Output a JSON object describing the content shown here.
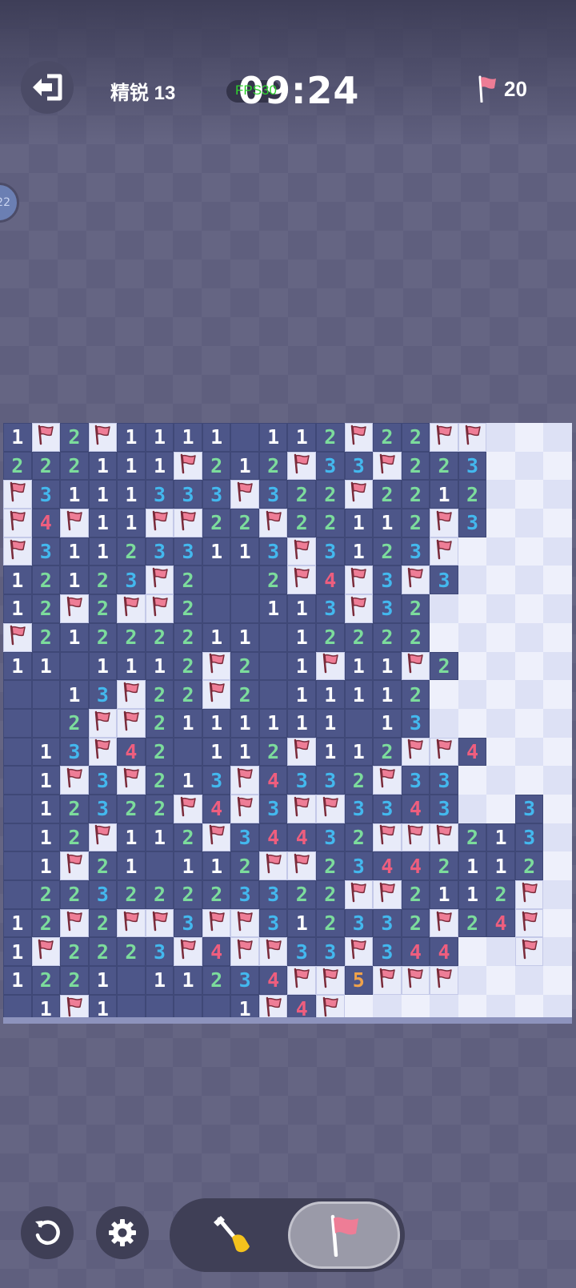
{
  "header": {
    "level_label": "精锐 13",
    "fps_label": "FPS30",
    "timer": "09:24",
    "flags_remaining": "20"
  },
  "side_badge": "22",
  "icons": {
    "exit": "exit-icon",
    "flag": "flag-icon",
    "restart": "restart-icon",
    "settings": "gear-icon",
    "dig": "shovel-icon"
  },
  "colors": {
    "revealed": "#4d5689",
    "n1": "#ffffff",
    "n2": "#7cdc9c",
    "n3": "#43b8ee",
    "n4": "#ee5e7e",
    "n5": "#f0a24a",
    "flag": "#ee7d96"
  },
  "board": {
    "cols": 20,
    "rows": [
      [
        "1",
        "F",
        "2",
        "F",
        "1",
        "1",
        "1",
        "1",
        "0",
        "1",
        "1",
        "2",
        "F",
        "2",
        "2",
        "F",
        "F",
        "H",
        "H",
        "H"
      ],
      [
        "2",
        "2",
        "2",
        "1",
        "1",
        "1",
        "F",
        "2",
        "1",
        "2",
        "F",
        "3",
        "3",
        "F",
        "2",
        "2",
        "3",
        "H",
        "H",
        "H"
      ],
      [
        "F",
        "3",
        "1",
        "1",
        "1",
        "3",
        "3",
        "3",
        "F",
        "3",
        "2",
        "2",
        "F",
        "2",
        "2",
        "1",
        "2",
        "H",
        "H",
        "H"
      ],
      [
        "F",
        "4",
        "F",
        "1",
        "1",
        "F",
        "F",
        "2",
        "2",
        "F",
        "2",
        "2",
        "1",
        "1",
        "2",
        "F",
        "3",
        "H",
        "H",
        "H"
      ],
      [
        "F",
        "3",
        "1",
        "1",
        "2",
        "3",
        "3",
        "1",
        "1",
        "3",
        "F",
        "3",
        "1",
        "2",
        "3",
        "F",
        "H",
        "H",
        "H",
        "H"
      ],
      [
        "1",
        "2",
        "1",
        "2",
        "3",
        "F",
        "2",
        "0",
        "0",
        "2",
        "F",
        "4",
        "F",
        "3",
        "F",
        "3",
        "H",
        "H",
        "H",
        "H"
      ],
      [
        "1",
        "2",
        "F",
        "2",
        "F",
        "F",
        "2",
        "0",
        "0",
        "1",
        "1",
        "3",
        "F",
        "3",
        "2",
        "H",
        "H",
        "H",
        "H",
        "H"
      ],
      [
        "F",
        "2",
        "1",
        "2",
        "2",
        "2",
        "2",
        "1",
        "1",
        "0",
        "1",
        "2",
        "2",
        "2",
        "2",
        "H",
        "H",
        "H",
        "H",
        "H"
      ],
      [
        "1",
        "1",
        "0",
        "1",
        "1",
        "1",
        "2",
        "F",
        "2",
        "0",
        "1",
        "F",
        "1",
        "1",
        "F",
        "2",
        "H",
        "H",
        "H",
        "H"
      ],
      [
        "0",
        "0",
        "1",
        "3",
        "F",
        "2",
        "2",
        "F",
        "2",
        "0",
        "1",
        "1",
        "1",
        "1",
        "2",
        "H",
        "H",
        "H",
        "H",
        "H"
      ],
      [
        "0",
        "0",
        "2",
        "F",
        "F",
        "2",
        "1",
        "1",
        "1",
        "1",
        "1",
        "1",
        "0",
        "1",
        "3",
        "H",
        "H",
        "H",
        "H",
        "H"
      ],
      [
        "0",
        "1",
        "3",
        "F",
        "4",
        "2",
        "0",
        "1",
        "1",
        "2",
        "F",
        "1",
        "1",
        "2",
        "F",
        "F",
        "4",
        "H",
        "H",
        "H"
      ],
      [
        "0",
        "1",
        "F",
        "3",
        "F",
        "2",
        "1",
        "3",
        "F",
        "4",
        "3",
        "3",
        "2",
        "F",
        "3",
        "3",
        "H",
        "H",
        "H",
        "H"
      ],
      [
        "0",
        "1",
        "2",
        "3",
        "2",
        "2",
        "F",
        "4",
        "F",
        "3",
        "F",
        "F",
        "3",
        "3",
        "4",
        "3",
        "H",
        "H",
        "3",
        "H"
      ],
      [
        "0",
        "1",
        "2",
        "F",
        "1",
        "1",
        "2",
        "F",
        "3",
        "4",
        "4",
        "3",
        "2",
        "F",
        "F",
        "F",
        "2",
        "1",
        "3",
        "H"
      ],
      [
        "0",
        "1",
        "F",
        "2",
        "1",
        "0",
        "1",
        "1",
        "2",
        "F",
        "F",
        "2",
        "3",
        "4",
        "4",
        "2",
        "1",
        "1",
        "2",
        "H"
      ],
      [
        "0",
        "2",
        "2",
        "3",
        "2",
        "2",
        "2",
        "2",
        "3",
        "3",
        "2",
        "2",
        "F",
        "F",
        "2",
        "1",
        "1",
        "2",
        "F",
        "H"
      ],
      [
        "1",
        "2",
        "F",
        "2",
        "F",
        "F",
        "3",
        "F",
        "F",
        "3",
        "1",
        "2",
        "3",
        "3",
        "2",
        "F",
        "2",
        "4",
        "F",
        "H"
      ],
      [
        "1",
        "F",
        "2",
        "2",
        "2",
        "3",
        "F",
        "4",
        "F",
        "F",
        "3",
        "3",
        "F",
        "3",
        "4",
        "4",
        "H",
        "H",
        "F",
        "H"
      ],
      [
        "1",
        "2",
        "2",
        "1",
        "0",
        "1",
        "1",
        "2",
        "3",
        "4",
        "F",
        "F",
        "5",
        "F",
        "F",
        "F",
        "H",
        "H",
        "H",
        "H"
      ],
      [
        "0",
        "1",
        "F",
        "1",
        "0",
        "0",
        "0",
        "0",
        "1",
        "F",
        "4",
        "F",
        "H",
        "H",
        "H",
        "H",
        "H",
        "H",
        "H",
        "H"
      ]
    ]
  }
}
